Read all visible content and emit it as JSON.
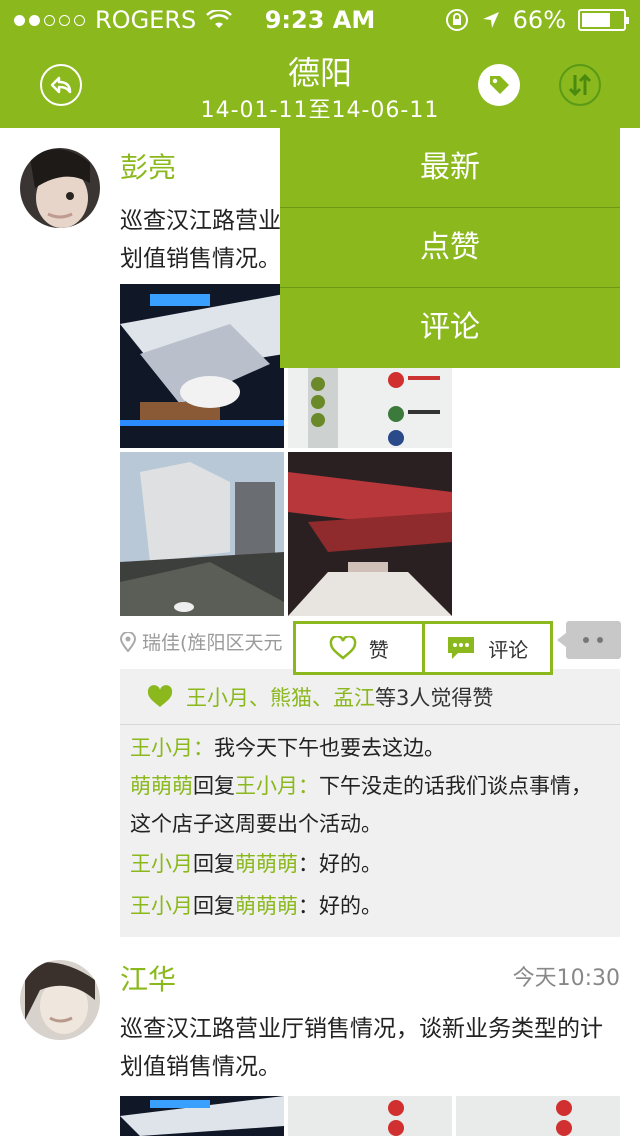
{
  "status": {
    "carrier": "ROGERS",
    "time": "9:23 AM",
    "battery": "66%"
  },
  "nav": {
    "title": "德阳",
    "range": "14-01-11至14-06-11"
  },
  "dropdown": [
    "最新",
    "点赞",
    "评论"
  ],
  "posts": [
    {
      "author": "彭亮",
      "content_visible_1": "巡查汉江路营业",
      "content_visible_2": "划值销售情况。",
      "location": "瑞佳(旌阳区天元",
      "actions": {
        "like": "赞",
        "comment": "评论"
      },
      "likes": {
        "names": "王小月、熊猫、孟江",
        "suffix": "等3人觉得赞"
      },
      "comments": [
        {
          "from": "王小月",
          "to": "",
          "text": "我今天下午也要去这边。"
        },
        {
          "from": "萌萌萌",
          "to": "王小月",
          "text": "下午没走的话我们谈点事情，这个店子这周要出个活动。"
        },
        {
          "from": "王小月",
          "to": "萌萌萌",
          "text": "好的。"
        },
        {
          "from": "王小月",
          "to": "萌萌萌",
          "text": "好的。"
        }
      ]
    },
    {
      "author": "江华",
      "time": "今天10:30",
      "content": "巡查汉江路营业厅销售情况，谈新业务类型的计划值销售情况。"
    }
  ],
  "labels": {
    "reply": "回复",
    "colon": "：",
    "colon_small": ":"
  }
}
